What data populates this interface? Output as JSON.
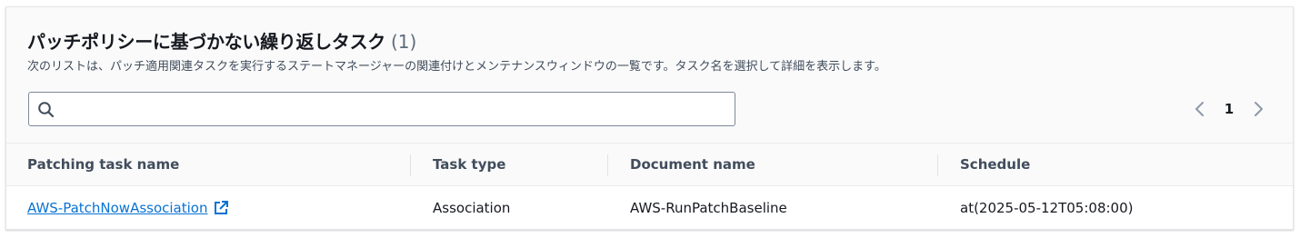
{
  "panel": {
    "title": "パッチポリシーに基づかない繰り返しタスク",
    "count": "(1)",
    "description": "次のリストは、パッチ適用関連タスクを実行するステートマネージャーの関連付けとメンテナンスウィンドウの一覧です。タスク名を選択して詳細を表示します。"
  },
  "search": {
    "value": "",
    "placeholder": "",
    "icon": "search-icon"
  },
  "pagination": {
    "current_page": "1",
    "prev_icon": "chevron-left-icon",
    "next_icon": "chevron-right-icon"
  },
  "table": {
    "columns": [
      "Patching task name",
      "Task type",
      "Document name",
      "Schedule"
    ],
    "rows": [
      {
        "name": "AWS-PatchNowAssociation",
        "type": "Association",
        "document": "AWS-RunPatchBaseline",
        "schedule": "at(2025-05-12T05:08:00)",
        "link_icon": "external-link-icon"
      }
    ]
  },
  "colors": {
    "link": "#0972d3",
    "header_bg": "#fafafa",
    "text": "#16191f",
    "muted": "#414d5c"
  }
}
